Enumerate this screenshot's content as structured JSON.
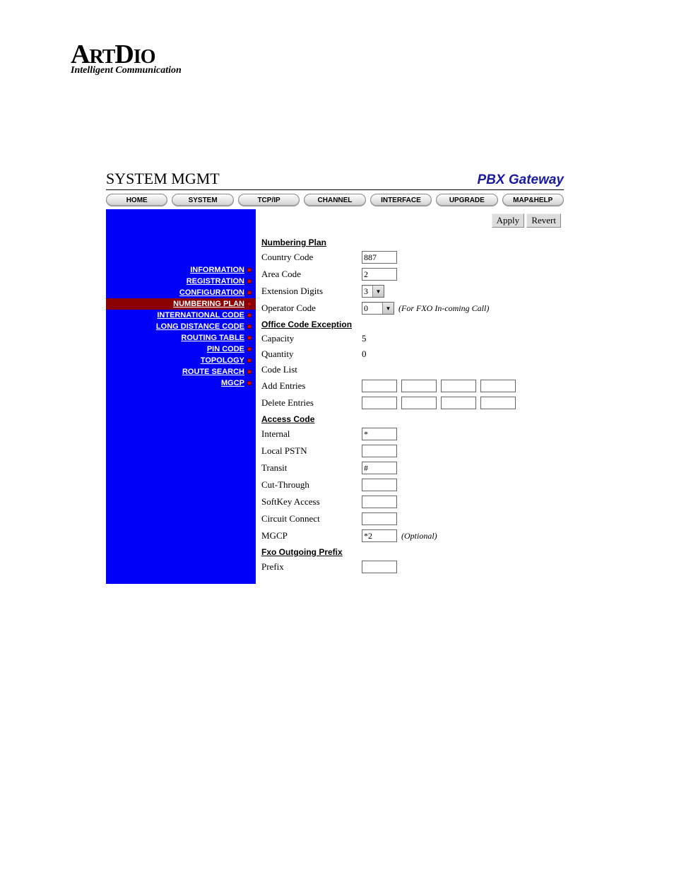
{
  "logo": {
    "main_a": "A",
    "main_b": "RT",
    "main_c": "D",
    "main_d": "IO",
    "tag": "Intelligent Communication"
  },
  "titles": {
    "left": "SYSTEM MGMT",
    "right": "PBX Gateway"
  },
  "tabs": [
    "HOME",
    "SYSTEM",
    "TCP/IP",
    "CHANNEL",
    "INTERFACE",
    "UPGRADE",
    "MAP&HELP"
  ],
  "sidebar": {
    "items": [
      {
        "label": "INFORMATION",
        "active": false
      },
      {
        "label": "REGISTRATION",
        "active": false
      },
      {
        "label": "CONFIGURATION",
        "active": false
      },
      {
        "label": "NUMBERING PLAN",
        "active": true
      },
      {
        "label": "INTERNATIONAL CODE",
        "active": false
      },
      {
        "label": "LONG DISTANCE CODE",
        "active": false
      },
      {
        "label": "ROUTING TABLE",
        "active": false
      },
      {
        "label": "PIN CODE",
        "active": false
      },
      {
        "label": "TOPOLOGY",
        "active": false
      },
      {
        "label": "ROUTE SEARCH",
        "active": false
      },
      {
        "label": "MGCP",
        "active": false
      }
    ]
  },
  "actions": {
    "apply": "Apply",
    "revert": "Revert"
  },
  "sections": {
    "numbering_plan": {
      "heading": "Numbering Plan",
      "country_code": {
        "label": "Country Code",
        "value": "887"
      },
      "area_code": {
        "label": "Area Code",
        "value": "2"
      },
      "extension_digits": {
        "label": "Extension Digits",
        "value": "3"
      },
      "operator_code": {
        "label": "Operator Code",
        "value": "0",
        "hint": "(For FXO In-coming Call)"
      }
    },
    "office_exception": {
      "heading": "Office Code Exception",
      "capacity": {
        "label": "Capacity",
        "value": "5"
      },
      "quantity": {
        "label": "Quantity",
        "value": "0"
      },
      "code_list": {
        "label": "Code List"
      },
      "add_entries": {
        "label": "Add Entries",
        "values": [
          "",
          "",
          "",
          ""
        ]
      },
      "delete_entries": {
        "label": "Delete Entries",
        "values": [
          "",
          "",
          "",
          ""
        ]
      }
    },
    "access_code": {
      "heading": "Access Code",
      "internal": {
        "label": "Internal",
        "value": "*"
      },
      "local_pstn": {
        "label": "Local PSTN",
        "value": ""
      },
      "transit": {
        "label": "Transit",
        "value": "#"
      },
      "cut_through": {
        "label": "Cut-Through",
        "value": ""
      },
      "softkey": {
        "label": "SoftKey Access",
        "value": ""
      },
      "circuit": {
        "label": "Circuit Connect",
        "value": ""
      },
      "mgcp": {
        "label": "MGCP",
        "value": "*2",
        "hint": "(Optional)"
      }
    },
    "fxo_prefix": {
      "heading": "Fxo Outgoing Prefix",
      "prefix": {
        "label": "Prefix",
        "value": ""
      }
    }
  }
}
